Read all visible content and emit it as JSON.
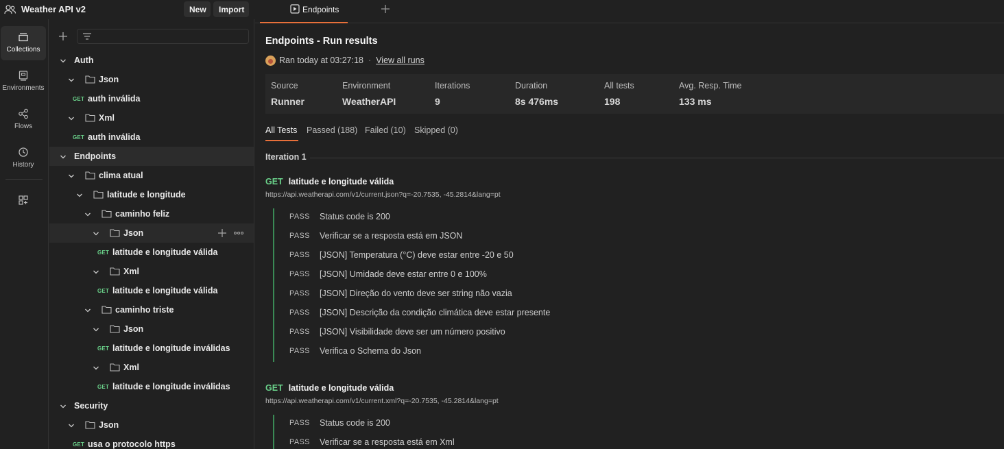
{
  "workspace": {
    "title": "Weather API v2",
    "new_label": "New",
    "import_label": "Import"
  },
  "rail": [
    {
      "label": "Collections",
      "icon": "collections-icon",
      "active": true
    },
    {
      "label": "Environments",
      "icon": "environments-icon",
      "active": false
    },
    {
      "label": "Flows",
      "icon": "flows-icon",
      "active": false
    },
    {
      "label": "History",
      "icon": "history-icon",
      "active": false
    }
  ],
  "tree": [
    {
      "label": "Auth",
      "type": "collection",
      "level": 0
    },
    {
      "label": "Json",
      "type": "folder",
      "level": 1
    },
    {
      "label": "auth inválida",
      "type": "request",
      "method": "GET",
      "level": 1
    },
    {
      "label": "Xml",
      "type": "folder",
      "level": 1
    },
    {
      "label": "auth inválida",
      "type": "request",
      "method": "GET",
      "level": 1
    },
    {
      "label": "Endpoints",
      "type": "collection",
      "level": 0,
      "selected": true
    },
    {
      "label": "clima atual",
      "type": "folder",
      "level": 1
    },
    {
      "label": "latitude e longitude",
      "type": "folder",
      "level": 2
    },
    {
      "label": "caminho feliz",
      "type": "folder",
      "level": 3
    },
    {
      "label": "Json",
      "type": "folder",
      "level": 4,
      "hover": true
    },
    {
      "label": "latitude e longitude válida",
      "type": "request",
      "method": "GET",
      "level": 4
    },
    {
      "label": "Xml",
      "type": "folder",
      "level": 4
    },
    {
      "label": "latitude e longitude válida",
      "type": "request",
      "method": "GET",
      "level": 4
    },
    {
      "label": "caminho triste",
      "type": "folder",
      "level": 3
    },
    {
      "label": "Json",
      "type": "folder",
      "level": 4
    },
    {
      "label": "latitude e longitude inválidas",
      "type": "request",
      "method": "GET",
      "level": 4
    },
    {
      "label": "Xml",
      "type": "folder",
      "level": 4
    },
    {
      "label": "latitude e longitude inválidas",
      "type": "request",
      "method": "GET",
      "level": 4
    },
    {
      "label": "Security",
      "type": "collection",
      "level": 0
    },
    {
      "label": "Json",
      "type": "folder",
      "level": 1
    },
    {
      "label": "usa o protocolo https",
      "type": "request",
      "method": "GET",
      "level": 1
    }
  ],
  "tab": {
    "label": "Endpoints"
  },
  "main": {
    "title": "Endpoints - Run results",
    "ran_text": "Ran today at 03:27:18",
    "separator": "·",
    "view_all": "View all runs",
    "stats": [
      {
        "label": "Source",
        "value": "Runner"
      },
      {
        "label": "Environment",
        "value": "WeatherAPI"
      },
      {
        "label": "Iterations",
        "value": "9"
      },
      {
        "label": "Duration",
        "value": "8s 476ms"
      },
      {
        "label": "All tests",
        "value": "198"
      },
      {
        "label": "Avg. Resp. Time",
        "value": "133 ms"
      }
    ],
    "result_tabs": [
      "All Tests",
      "Passed (188)",
      "Failed (10)",
      "Skipped (0)"
    ],
    "iteration_label": "Iteration 1",
    "requests": [
      {
        "method": "GET",
        "name": "latitude e longitude válida",
        "url": "https://api.weatherapi.com/v1/current.json?q=-20.7535, -45.2814&lang=pt",
        "tests": [
          {
            "status": "PASS",
            "name": "Status code is 200"
          },
          {
            "status": "PASS",
            "name": "Verificar se a resposta está em JSON"
          },
          {
            "status": "PASS",
            "name": "[JSON] Temperatura (°C) deve estar entre -20 e 50"
          },
          {
            "status": "PASS",
            "name": "[JSON] Umidade deve estar entre 0 e 100%"
          },
          {
            "status": "PASS",
            "name": "[JSON] Direção do vento deve ser string não vazia"
          },
          {
            "status": "PASS",
            "name": "[JSON] Descrição da condição climática deve estar presente"
          },
          {
            "status": "PASS",
            "name": "[JSON] Visibilidade deve ser um número positivo"
          },
          {
            "status": "PASS",
            "name": "Verifica o Schema do Json"
          }
        ]
      },
      {
        "method": "GET",
        "name": "latitude e longitude válida",
        "url": "https://api.weatherapi.com/v1/current.xml?q=-20.7535, -45.2814&lang=pt",
        "tests": [
          {
            "status": "PASS",
            "name": "Status code is 200"
          },
          {
            "status": "PASS",
            "name": "Verificar se a resposta está em Xml"
          }
        ]
      }
    ]
  },
  "colors": {
    "accent": "#e8703a",
    "get": "#6ad18a",
    "pass_bar": "#3a8a55"
  }
}
